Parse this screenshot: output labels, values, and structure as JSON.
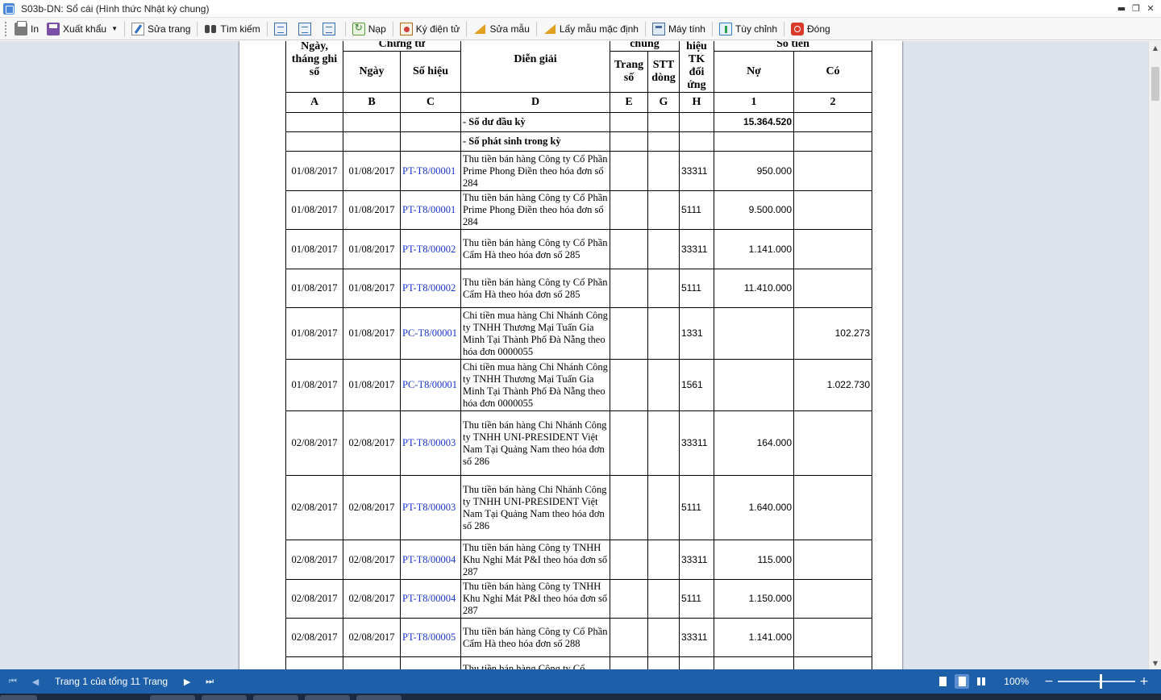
{
  "window": {
    "title": "S03b-DN: Sổ cái (Hình thức Nhật ký chung)"
  },
  "toolbar": {
    "print": "In",
    "export": "Xuất khẩu",
    "edit_page": "Sửa trang",
    "search": "Tìm kiếm",
    "load": "Nạp",
    "sign": "Ký điện tử",
    "edit_template": "Sửa mẫu",
    "default_template": "Lấy mẫu mặc định",
    "calculator": "Máy tính",
    "customize": "Tùy chỉnh",
    "close": "Đóng"
  },
  "ledger": {
    "headers": {
      "date_header": "Ngày, tháng ghi sổ",
      "voucher_header": "Chứng từ",
      "voucher_date": "Ngày",
      "voucher_no": "Số hiệu",
      "description": "Diễn giải",
      "journal_header": "chung",
      "page_no": "Trang số",
      "line_no": "STT dòng",
      "contra_header": "hiệu TK đối ứng",
      "amount_header": "Số tiền",
      "debit": "Nợ",
      "credit": "Có"
    },
    "codes": [
      "A",
      "B",
      "C",
      "D",
      "E",
      "G",
      "H",
      "1",
      "2"
    ],
    "opening_label": "- Số dư đầu kỳ",
    "opening_debit": "15.364.520",
    "period_label": "- Số phát sinh trong kỳ",
    "rows": [
      {
        "date": "01/08/2017",
        "vdate": "01/08/2017",
        "vno": "PT-T8/00001",
        "desc": "Thu tiền bán hàng Công ty Cổ Phần Prime Phong Điền theo hóa đơn số 284",
        "acc": "33311",
        "debit": "950.000",
        "credit": ""
      },
      {
        "date": "01/08/2017",
        "vdate": "01/08/2017",
        "vno": "PT-T8/00001",
        "desc": "Thu tiền bán hàng Công ty Cổ Phần Prime Phong Điền theo hóa đơn số 284",
        "acc": "5111",
        "debit": "9.500.000",
        "credit": ""
      },
      {
        "date": "01/08/2017",
        "vdate": "01/08/2017",
        "vno": "PT-T8/00002",
        "desc": "Thu tiền bán hàng Công ty Cổ Phần Cẩm Hà theo hóa đơn số 285",
        "acc": "33311",
        "debit": "1.141.000",
        "credit": ""
      },
      {
        "date": "01/08/2017",
        "vdate": "01/08/2017",
        "vno": "PT-T8/00002",
        "desc": "Thu tiền bán hàng Công ty Cổ Phần Cẩm Hà theo hóa đơn số 285",
        "acc": "5111",
        "debit": "11.410.000",
        "credit": ""
      },
      {
        "date": "01/08/2017",
        "vdate": "01/08/2017",
        "vno": "PC-T8/00001",
        "desc": "Chi tiền mua hàng Chi Nhánh Công ty TNHH Thương Mại Tuấn Gia Minh Tại Thành Phố Đà Nẵng theo hóa đơn 0000055",
        "acc": "1331",
        "debit": "",
        "credit": "102.273"
      },
      {
        "date": "01/08/2017",
        "vdate": "01/08/2017",
        "vno": "PC-T8/00001",
        "desc": "Chi tiền mua hàng Chi Nhánh Công ty TNHH Thương Mại Tuấn Gia Minh Tại Thành Phố Đà Nẵng theo hóa đơn 0000055",
        "acc": "1561",
        "debit": "",
        "credit": "1.022.730"
      },
      {
        "date": "02/08/2017",
        "vdate": "02/08/2017",
        "vno": "PT-T8/00003",
        "desc": "Thu tiền bán hàng Chi Nhánh Công ty TNHH UNI-PRESIDENT Việt Nam Tại Quảng Nam theo hóa đơn số 286",
        "acc": "33311",
        "debit": "164.000",
        "credit": ""
      },
      {
        "date": "02/08/2017",
        "vdate": "02/08/2017",
        "vno": "PT-T8/00003",
        "desc": "Thu tiền bán hàng Chi Nhánh Công ty TNHH UNI-PRESIDENT Việt Nam Tại Quảng Nam theo hóa đơn số 286",
        "acc": "5111",
        "debit": "1.640.000",
        "credit": ""
      },
      {
        "date": "02/08/2017",
        "vdate": "02/08/2017",
        "vno": "PT-T8/00004",
        "desc": "Thu tiền bán hàng Công ty TNHH Khu Nghỉ Mát P&I theo hóa đơn số 287",
        "acc": "33311",
        "debit": "115.000",
        "credit": ""
      },
      {
        "date": "02/08/2017",
        "vdate": "02/08/2017",
        "vno": "PT-T8/00004",
        "desc": "Thu tiền bán hàng Công ty TNHH Khu Nghỉ Mát P&I theo hóa đơn số 287",
        "acc": "5111",
        "debit": "1.150.000",
        "credit": ""
      },
      {
        "date": "02/08/2017",
        "vdate": "02/08/2017",
        "vno": "PT-T8/00005",
        "desc": "Thu tiền bán hàng Công ty Cổ Phần Cẩm Hà theo hóa đơn số 288",
        "acc": "33311",
        "debit": "1.141.000",
        "credit": ""
      },
      {
        "date": "",
        "vdate": "",
        "vno": "",
        "desc": "Thu tiền bán hàng Công ty Cổ",
        "acc": "",
        "debit": "",
        "credit": ""
      }
    ]
  },
  "status": {
    "page_info": "Trang 1 của tổng 11 Trang",
    "zoom": "100%"
  },
  "colors": {
    "statusbar": "#1d5fa8",
    "viewer_bg": "#dce3ec",
    "voucher_link": "#1b35c7"
  }
}
